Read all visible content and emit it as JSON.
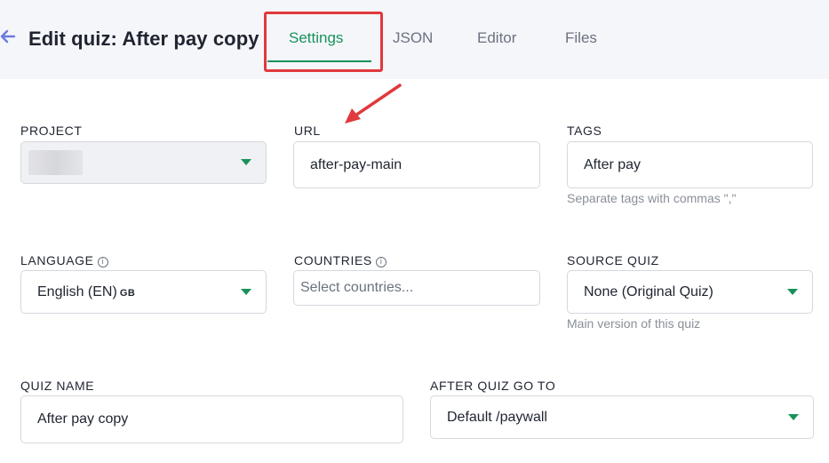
{
  "header": {
    "title": "Edit quiz: After pay copy",
    "tabs": [
      {
        "label": "Settings",
        "active": true
      },
      {
        "label": "JSON",
        "active": false
      },
      {
        "label": "Editor",
        "active": false
      },
      {
        "label": "Files",
        "active": false
      }
    ]
  },
  "form": {
    "project": {
      "label": "PROJECT",
      "value": ""
    },
    "url": {
      "label": "URL",
      "value": "after-pay-main"
    },
    "tags": {
      "label": "TAGS",
      "value": "After pay",
      "help": "Separate tags with commas \",\""
    },
    "language": {
      "label": "LANGUAGE",
      "value": "English (EN)",
      "region": "GB"
    },
    "countries": {
      "label": "COUNTRIES",
      "placeholder": "Select countries..."
    },
    "source_quiz": {
      "label": "SOURCE QUIZ",
      "value": "None (Original Quiz)",
      "help": "Main version of this quiz"
    },
    "quiz_name": {
      "label": "QUIZ NAME",
      "value": "After pay copy"
    },
    "after_quiz": {
      "label": "AFTER QUIZ GO TO",
      "value": "Default /paywall"
    }
  },
  "colors": {
    "accent": "#17925b",
    "annotation": "#e0393e",
    "back_icon": "#6c7ae0"
  }
}
